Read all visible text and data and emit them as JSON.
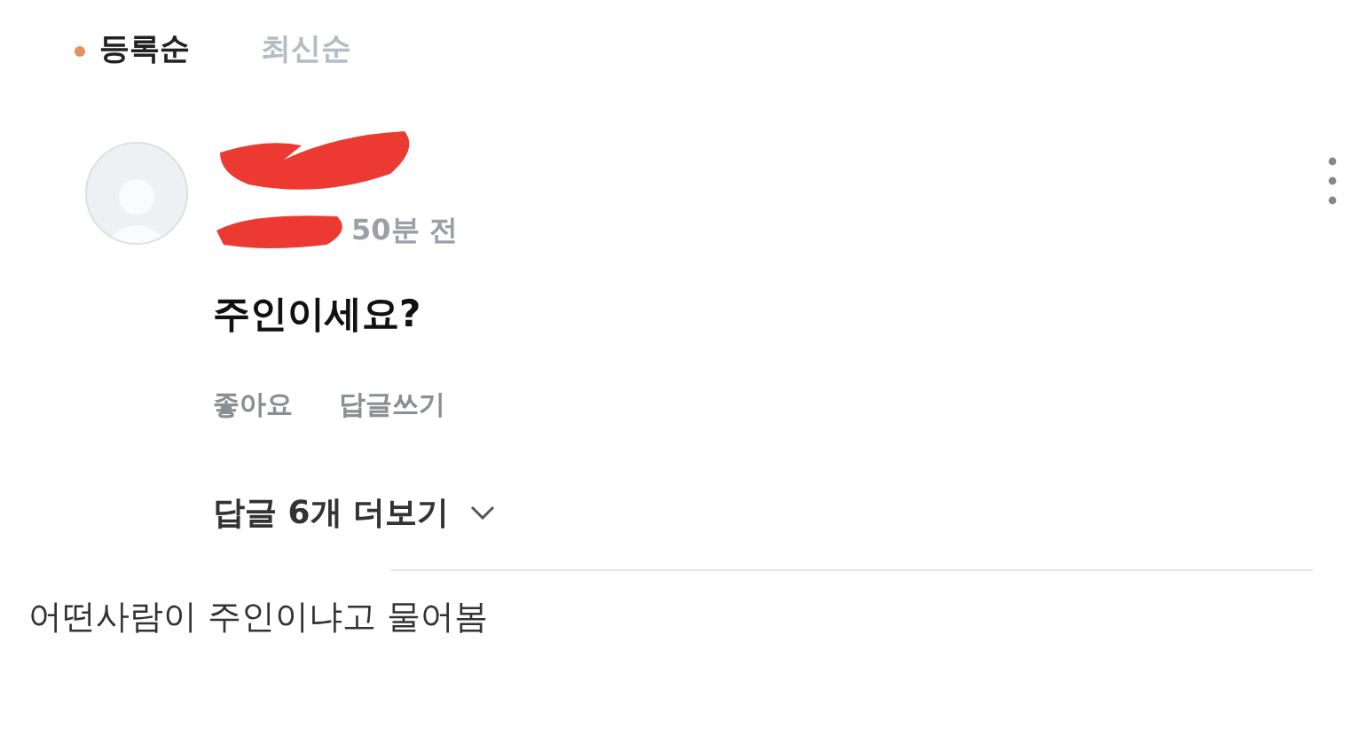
{
  "sort_tabs": [
    {
      "label": "등록순",
      "selected": true
    },
    {
      "label": "최신순",
      "selected": false
    }
  ],
  "comment": {
    "time": "50분 전",
    "text": "주인이세요?",
    "actions": [
      "좋아요",
      "답글쓰기"
    ],
    "replies_toggle": "답글 6개 더보기"
  },
  "caption": "어떤사람이 주인이냐고 물어봄"
}
